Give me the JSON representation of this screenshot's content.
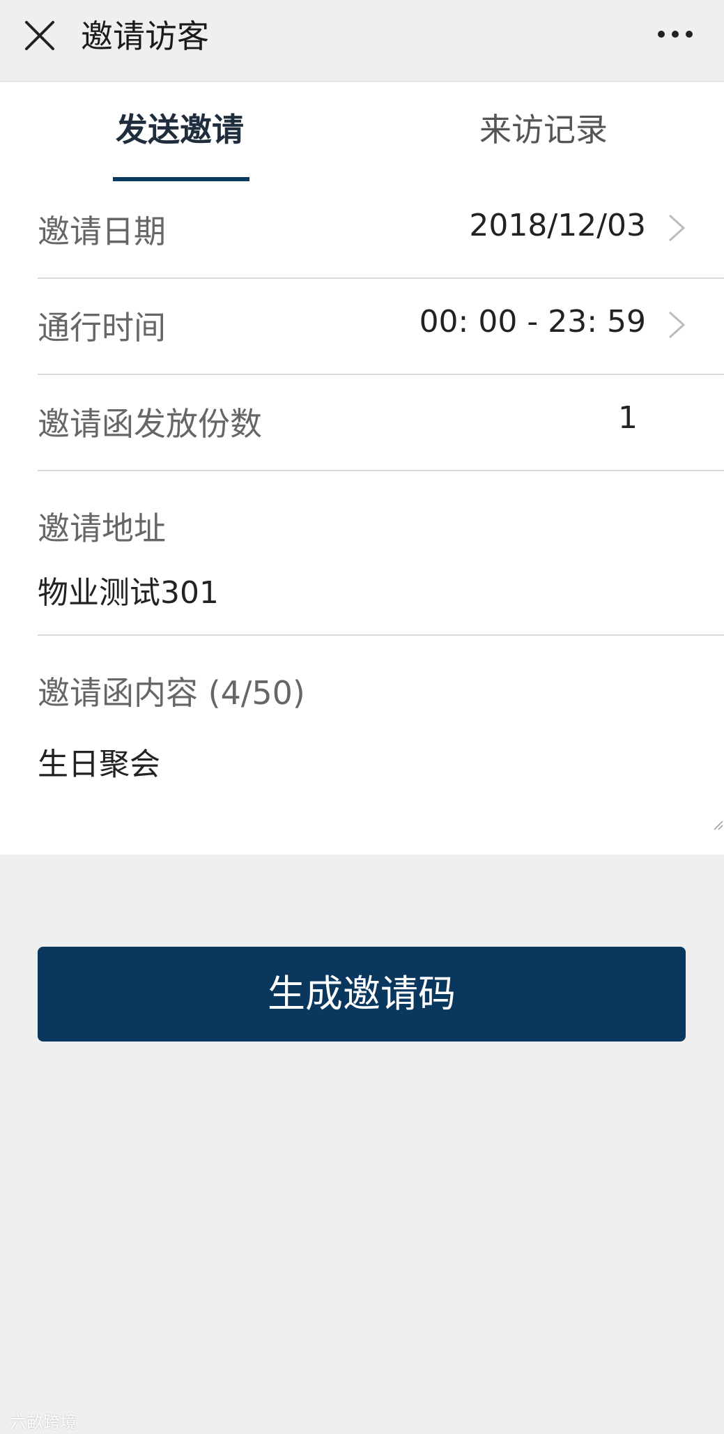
{
  "header": {
    "title": "邀请访客",
    "close_icon": "close-icon",
    "more_icon": "more-dots-icon"
  },
  "tabs": [
    {
      "label": "发送邀请",
      "active": true
    },
    {
      "label": "来访记录",
      "active": false
    }
  ],
  "form": {
    "date": {
      "label": "邀请日期",
      "value": "2018/12/03"
    },
    "time": {
      "label": "通行时间",
      "value": "00: 00 - 23: 59"
    },
    "count": {
      "label": "邀请函发放份数",
      "value": "1"
    },
    "address": {
      "label": "邀请地址",
      "value": "物业测试301"
    },
    "content": {
      "label": "邀请函内容 (4/50)",
      "value": "生日聚会"
    }
  },
  "actions": {
    "generate_label": "生成邀请码"
  },
  "watermark": {
    "text": "六畝跨境"
  },
  "colors": {
    "accent": "#09375e",
    "background": "#efeff0"
  }
}
